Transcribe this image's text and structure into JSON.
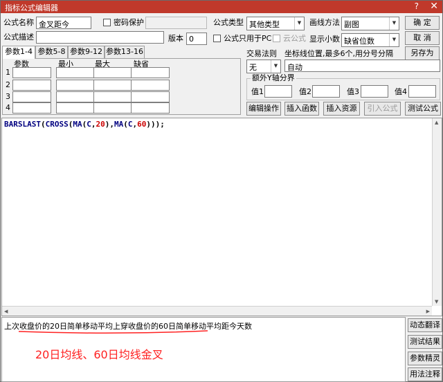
{
  "window": {
    "title": "指标公式编辑器",
    "help_glyph": "?",
    "close_glyph": "✕"
  },
  "form": {
    "name_label": "公式名称",
    "name_value": "金叉距今",
    "password_label": "密码保护",
    "desc_label": "公式描述",
    "version_label": "版本",
    "version_value": "0",
    "type_label": "公式类型",
    "type_value": "其他类型",
    "draw_label": "画线方法",
    "draw_value": "副图",
    "pc_only_label": "公式只用于PC",
    "cloud_label": "云公式",
    "decimals_label": "显示小数",
    "decimals_value": "缺省位数",
    "trade_rule_label": "交易法则",
    "trade_rule_value": "无",
    "coord_label": "坐标线位置,最多6个,用分号分隔",
    "coord_value": "自动",
    "yaxis_label": "额外Y轴分界",
    "y_values": [
      "值1",
      "值2",
      "值3",
      "值4"
    ]
  },
  "buttons": {
    "ok": "确  定",
    "cancel": "取  消",
    "save_as": "另存为",
    "edit_ops": "编辑操作",
    "insert_func": "插入函数",
    "insert_res": "插入资源",
    "import_formula": "引入公式",
    "test_formula": "测试公式"
  },
  "tabs": [
    "参数1-4",
    "参数5-8",
    "参数9-12",
    "参数13-16"
  ],
  "params": {
    "headers": [
      "参数",
      "最小",
      "最大",
      "缺省"
    ],
    "rows": [
      "1",
      "2",
      "3",
      "4"
    ]
  },
  "code": {
    "t1": "BARSLAST",
    "t2": "(",
    "t3": "CROSS",
    "t4": "(",
    "t5": "MA",
    "t6": "(",
    "t7": "C",
    "t8": ",",
    "t9": "20",
    "t10": "),",
    "t11": "MA",
    "t12": "(",
    "t13": "C",
    "t14": ",",
    "t15": "60",
    "t16": ")));"
  },
  "description": {
    "text": "上次收盘价的20日简单移动平均上穿收盘价的60日简单移动平均距今天数",
    "annotation": "20日均线、60日均线金叉"
  },
  "side_buttons": [
    "动态翻译",
    "测试结果",
    "参数精灵",
    "用法注释"
  ],
  "colors": {
    "title_bar": "#c0392b",
    "annotation": "#ff2020",
    "number": "#cc0000",
    "function": "#000080"
  }
}
